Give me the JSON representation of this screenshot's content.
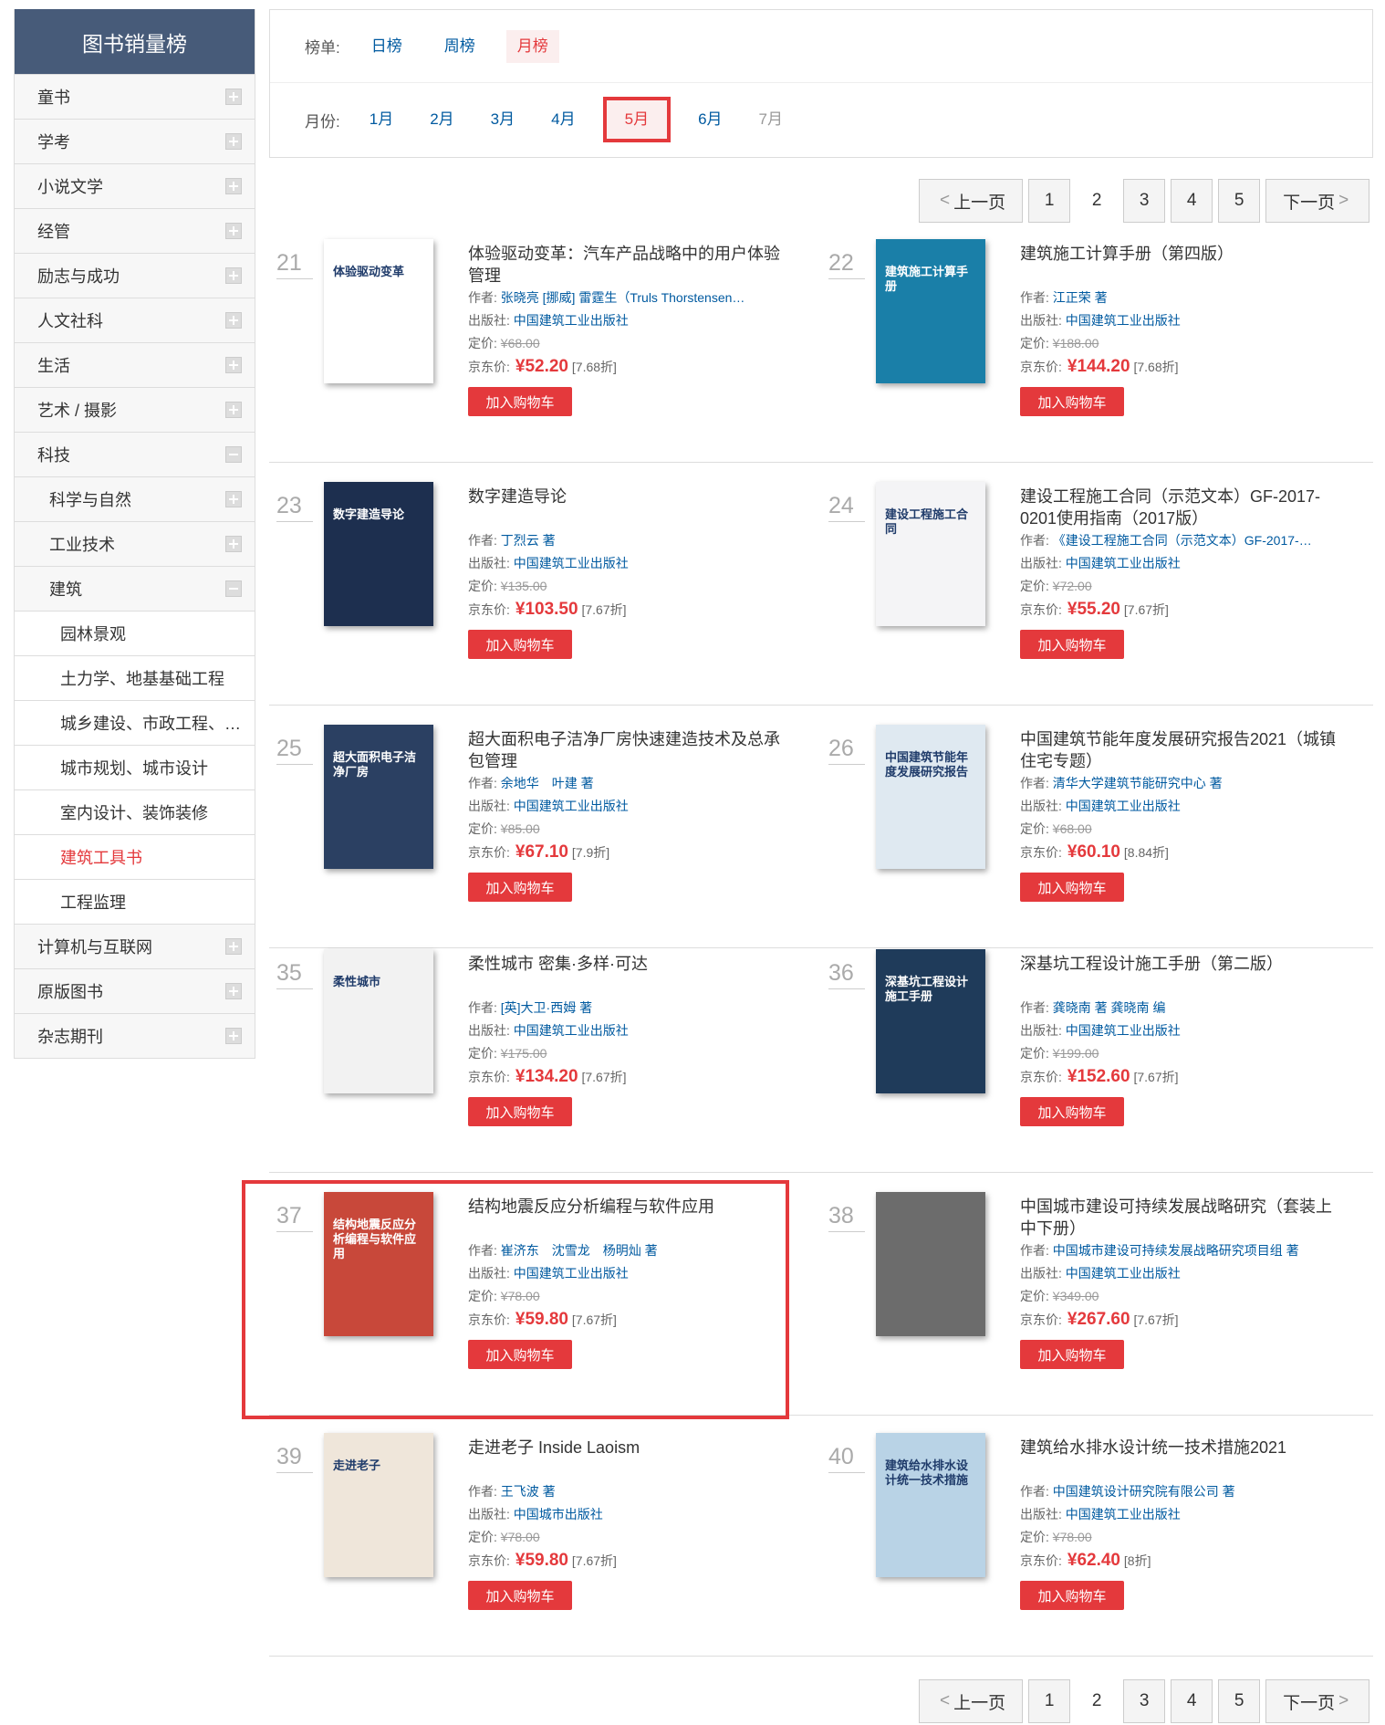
{
  "sidebar": {
    "title": "图书销量榜",
    "items": [
      {
        "label": "童书",
        "level": 1,
        "toggle": "plus"
      },
      {
        "label": "学考",
        "level": 1,
        "toggle": "plus"
      },
      {
        "label": "小说文学",
        "level": 1,
        "toggle": "plus"
      },
      {
        "label": "经管",
        "level": 1,
        "toggle": "plus"
      },
      {
        "label": "励志与成功",
        "level": 1,
        "toggle": "plus"
      },
      {
        "label": "人文社科",
        "level": 1,
        "toggle": "plus"
      },
      {
        "label": "生活",
        "level": 1,
        "toggle": "plus"
      },
      {
        "label": "艺术 / 摄影",
        "level": 1,
        "toggle": "plus"
      },
      {
        "label": "科技",
        "level": 1,
        "toggle": "minus"
      },
      {
        "label": "科学与自然",
        "level": 2,
        "toggle": "plus"
      },
      {
        "label": "工业技术",
        "level": 2,
        "toggle": "plus"
      },
      {
        "label": "建筑",
        "level": 2,
        "toggle": "minus"
      },
      {
        "label": "园林景观",
        "level": 3
      },
      {
        "label": "土力学、地基基础工程",
        "level": 3
      },
      {
        "label": "城乡建设、市政工程、…",
        "level": 3
      },
      {
        "label": "城市规划、城市设计",
        "level": 3
      },
      {
        "label": "室内设计、装饰装修",
        "level": 3
      },
      {
        "label": "建筑工具书",
        "level": 3,
        "active": true
      },
      {
        "label": "工程监理",
        "level": 3
      },
      {
        "label": "计算机与互联网",
        "level": 1,
        "toggle": "plus"
      },
      {
        "label": "原版图书",
        "level": 1,
        "toggle": "plus"
      },
      {
        "label": "杂志期刊",
        "level": 1,
        "toggle": "plus"
      }
    ]
  },
  "filter": {
    "list_label": "榜单:",
    "lists": [
      "日榜",
      "周榜",
      "月榜"
    ],
    "month_label": "月份:",
    "months": [
      "1月",
      "2月",
      "3月",
      "4月",
      "5月",
      "6月",
      "7月"
    ]
  },
  "pager": {
    "prev": "上一页",
    "next": "下一页",
    "pages": [
      "1",
      "2",
      "3",
      "4",
      "5"
    ],
    "current": "2"
  },
  "labels": {
    "author": "作者:",
    "publisher": "出版社:",
    "list_price": "定价:",
    "jd_price": "京东价:",
    "cart": "加入购物车"
  },
  "books": [
    {
      "rank": "21",
      "title": "体验驱动变革：汽车产品战略中的用户体验管理",
      "author": "张晓亮 [挪威] 雷霆生（Truls Thorstensen…",
      "publisher": "中国建筑工业出版社",
      "list_price": "¥68.00",
      "price": "¥52.20",
      "discount": "[7.68折]",
      "cover_color": "#ffffff",
      "cover_text": "体验驱动变革"
    },
    {
      "rank": "22",
      "title": "建筑施工计算手册（第四版）",
      "author": "江正荣 著",
      "publisher": "中国建筑工业出版社",
      "list_price": "¥188.00",
      "price": "¥144.20",
      "discount": "[7.68折]",
      "cover_color": "#1a7fa8",
      "cover_text": "建筑施工计算手册"
    },
    {
      "rank": "23",
      "title": "数字建造导论",
      "author": "丁烈云 著",
      "publisher": "中国建筑工业出版社",
      "list_price": "¥135.00",
      "price": "¥103.50",
      "discount": "[7.67折]",
      "cover_color": "#1d2f4f",
      "cover_text": "数字建造导论"
    },
    {
      "rank": "24",
      "title": "建设工程施工合同（示范文本）GF-2017-0201使用指南（2017版）",
      "author": "《建设工程施工合同（示范文本）GF-2017-…",
      "publisher": "中国建筑工业出版社",
      "list_price": "¥72.00",
      "price": "¥55.20",
      "discount": "[7.67折]",
      "cover_color": "#f4f4f6",
      "cover_text": "建设工程施工合同"
    },
    {
      "rank": "25",
      "title": "超大面积电子洁净厂房快速建造技术及总承包管理",
      "author": "余地华　叶建 著",
      "publisher": "中国建筑工业出版社",
      "list_price": "¥85.00",
      "price": "¥67.10",
      "discount": "[7.9折]",
      "cover_color": "#2b4062",
      "cover_text": "超大面积电子洁净厂房"
    },
    {
      "rank": "26",
      "title": "中国建筑节能年度发展研究报告2021（城镇住宅专题）",
      "author": "清华大学建筑节能研究中心 著",
      "publisher": "中国建筑工业出版社",
      "list_price": "¥68.00",
      "price": "¥60.10",
      "discount": "[8.84折]",
      "cover_color": "#dfe9f1",
      "cover_text": "中国建筑节能年度发展研究报告"
    },
    {
      "rank": "35",
      "title": "柔性城市 密集·多样·可达",
      "author": "[英]大卫·西姆 著",
      "publisher": "中国建筑工业出版社",
      "list_price": "¥175.00",
      "price": "¥134.20",
      "discount": "[7.67折]",
      "cover_color": "#f2f2f2",
      "cover_text": "柔性城市"
    },
    {
      "rank": "36",
      "title": "深基坑工程设计施工手册（第二版）",
      "author": "龚晓南 著 龚晓南 编",
      "publisher": "中国建筑工业出版社",
      "list_price": "¥199.00",
      "price": "¥152.60",
      "discount": "[7.67折]",
      "cover_color": "#1f3b5a",
      "cover_text": "深基坑工程设计施工手册"
    },
    {
      "rank": "37",
      "title": "结构地震反应分析编程与软件应用",
      "author": "崔济东　沈雪龙　杨明灿 著",
      "publisher": "中国建筑工业出版社",
      "list_price": "¥78.00",
      "price": "¥59.80",
      "discount": "[7.67折]",
      "cover_color": "#c8483a",
      "cover_text": "结构地震反应分析编程与软件应用"
    },
    {
      "rank": "38",
      "title": "中国城市建设可持续发展战略研究（套装上中下册）",
      "author": "中国城市建设可持续发展战略研究项目组 著",
      "publisher": "中国建筑工业出版社",
      "list_price": "¥349.00",
      "price": "¥267.60",
      "discount": "[7.67折]",
      "cover_color": "#6c6c6c",
      "cover_text": ""
    },
    {
      "rank": "39",
      "title": "走进老子 Inside Laoism",
      "author": "王飞波 著",
      "publisher": "中国城市出版社",
      "list_price": "¥78.00",
      "price": "¥59.80",
      "discount": "[7.67折]",
      "cover_color": "#efe6da",
      "cover_text": "走进老子"
    },
    {
      "rank": "40",
      "title": "建筑给水排水设计统一技术措施2021",
      "author": "中国建筑设计研究院有限公司 著",
      "publisher": "中国建筑工业出版社",
      "list_price": "¥78.00",
      "price": "¥62.40",
      "discount": "[8折]",
      "cover_color": "#b9d3e6",
      "cover_text": "建筑给水排水设计统一技术措施"
    }
  ]
}
